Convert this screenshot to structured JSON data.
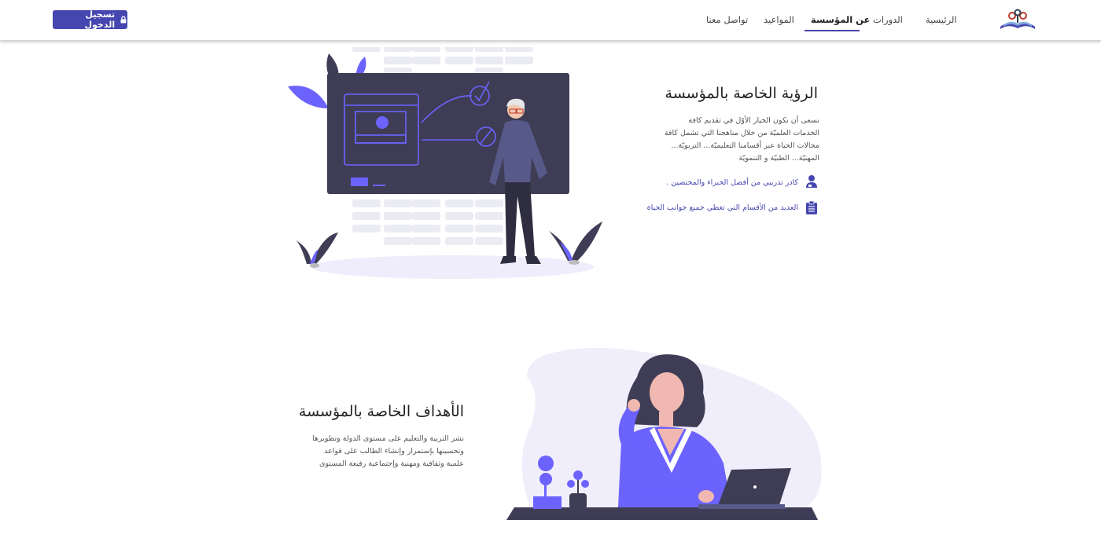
{
  "header": {
    "login_label": "تسجيل الدخول",
    "nav": [
      {
        "label": "الرئيسية"
      },
      {
        "label": "الدورات"
      },
      {
        "label": "عن المؤسسة",
        "active": true
      },
      {
        "label": "المواعيد"
      },
      {
        "label": "تواصل معنا"
      }
    ]
  },
  "vision": {
    "title": "الرؤية الخاصة بالمؤسسة",
    "paragraph": "نسعى أن نكون الخيار الأوّل في تقديم كافة الخدمات العلميّة من خلال مناهجنا التي تشمل كافة مجالات الحياة عبر أقسامنا التعليميّة... التربويّة... المهنيّة... الطبيّة و التنمويّة",
    "features": [
      {
        "label": "كادر تدريبي من أفضل الخبراء والمختصين .",
        "icon": "trainer-icon"
      },
      {
        "label": "العديد من الأقسام التي تغطي جميع جوانب الحياة",
        "icon": "clipboard-icon"
      }
    ]
  },
  "goals": {
    "title": "الأهداف الخاصة بالمؤسسة",
    "paragraph": "نشر التربية والتعليم على مستوى الدولة وتطويرها وتحسينها بإستمرار وإنشاء الطالب على قواعد علمية وثقافية ومهنية وإجتماعية رفيعة المستوى"
  },
  "colors": {
    "accent": "#4546b0",
    "illustration_purple": "#6c63ff",
    "board": "#3f3d56",
    "blob": "#f0eefb"
  }
}
